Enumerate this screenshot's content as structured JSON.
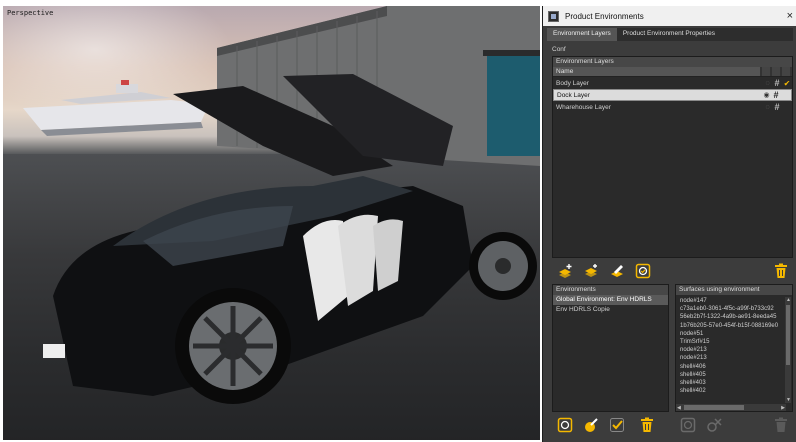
{
  "viewport": {
    "label": "Perspective"
  },
  "panel": {
    "title": "Product Environments",
    "close_glyph": "×",
    "tabs": [
      {
        "label": "Environment Layers",
        "active": true
      },
      {
        "label": "Product Environment Properties",
        "active": false
      }
    ],
    "conf_label": "Conf",
    "layers_header": "Environment Layers",
    "name_column": "Name",
    "layers": [
      {
        "name": "Body Layer",
        "eye_icon": "eye-closed-icon",
        "hash": "#",
        "checked": true,
        "selected": false
      },
      {
        "name": "Dock Layer",
        "eye_icon": "eye-open-icon",
        "hash": "#",
        "checked": false,
        "selected": true
      },
      {
        "name": "Wharehouse Layer",
        "eye_icon": "eye-closed-icon",
        "hash": "#",
        "checked": false,
        "selected": false
      }
    ],
    "environments_header": "Environments",
    "environments": [
      {
        "name": "Global Environment: Env HDRLS",
        "selected": true
      },
      {
        "name": "Env HDRLS Copie",
        "selected": false
      }
    ],
    "surfaces_header": "Surfaces using environment",
    "surfaces": [
      "node#147",
      "c73a1eb0-3061-4f5c-a99f-b733c92",
      "56eb2b7f-1322-4a9b-ae91-8eeda45",
      "1b76b205-57e0-454f-b15f-088169e0",
      "node#51",
      "TrimSrf#15",
      "node#213",
      "node#213",
      "shell#406",
      "shell#405",
      "shell#403",
      "shell#402"
    ],
    "accent_color": "#f5b800",
    "icons": {
      "layer_tools": [
        "add-layer-icon",
        "add-layer-alt-icon",
        "edit-layer-icon",
        "apply-layer-icon",
        "delete-layer-icon"
      ],
      "env_tools": [
        "apply-environment-icon",
        "edit-environment-icon",
        "confirm-icon",
        "delete-environment-icon"
      ],
      "surface_tools": [
        "select-surfaces-icon",
        "remove-surfaces-icon",
        "delete-surfaces-icon"
      ]
    }
  }
}
